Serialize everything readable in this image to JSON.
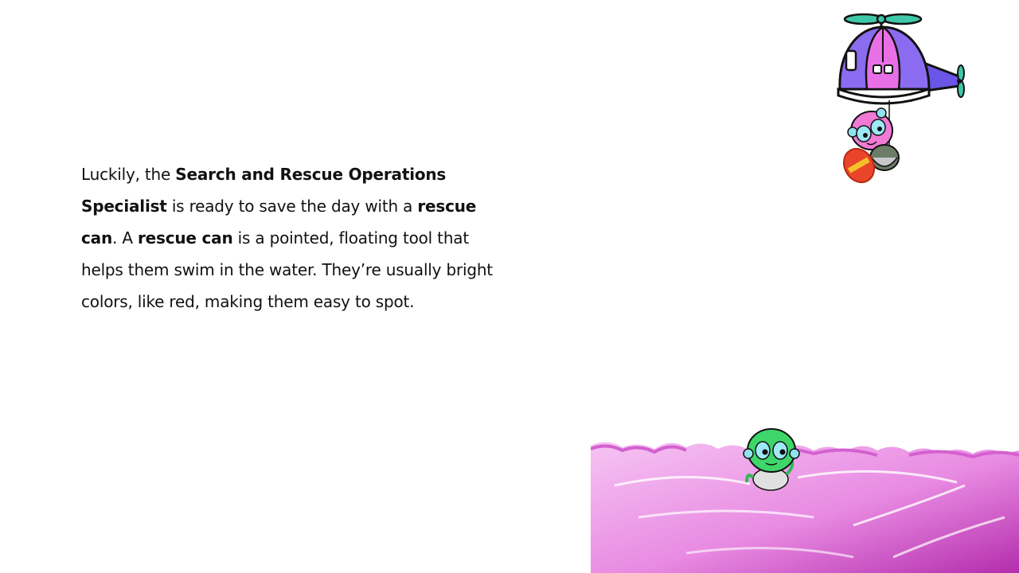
{
  "story": {
    "s1": "Luckily, the ",
    "s2": "Search and Rescue Operations Specialist",
    "s3": " is ready to save the day with a ",
    "s4": "rescue can",
    "s5": ". A ",
    "s6": "rescue can",
    "s7": " is a pointed, floating tool that helps them swim in the water. They’re usually bright colors, like red, making them easy to spot."
  },
  "colors": {
    "sea_light": "#f6c4f3",
    "sea_mid": "#e88ae2",
    "sea_dark": "#b42dad",
    "heli_purple": "#8b6cf0",
    "heli_pink": "#e86fe6",
    "rotor": "#3fc8a8",
    "alien_green": "#3ed66a",
    "can_red": "#e8452a"
  },
  "icons": [
    "helicopter-icon",
    "pink-alien-icon",
    "rescue-can-icon",
    "green-alien-icon",
    "ocean-waves-icon"
  ]
}
